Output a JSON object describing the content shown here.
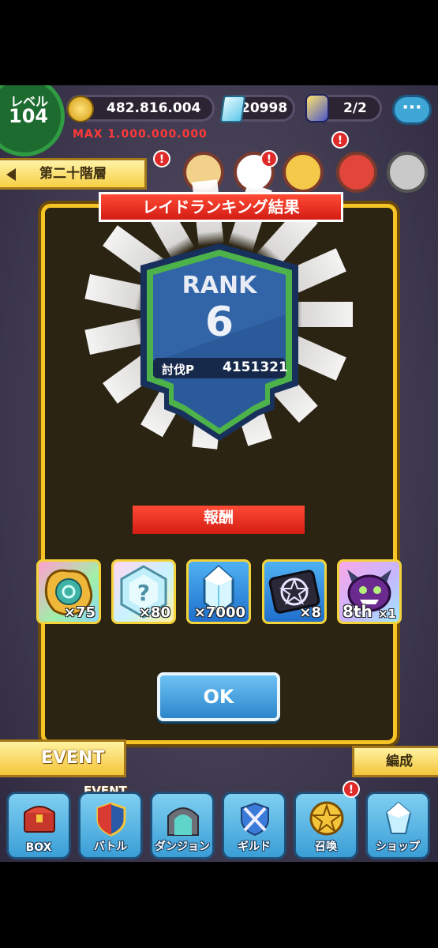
{
  "hud": {
    "level_label": "レベル",
    "level_value": "104",
    "gold": "482.816.004",
    "gold_max": "MAX 1.000.000.000",
    "gems": "20998",
    "stamina": "2/2",
    "chat_icon": "···",
    "floor": "第二十階層",
    "badges": [
      "!",
      "!",
      "!"
    ]
  },
  "dialog": {
    "title": "レイドランキング結果",
    "rank_label": "RANK",
    "rank_value": "6",
    "points_label": "討伐P",
    "points_value": "4151321",
    "reward_title": "報酬",
    "rewards": [
      {
        "icon": "gold-rune-icon",
        "qty": "×75"
      },
      {
        "icon": "mystery-crystal-icon",
        "qty": "×80"
      },
      {
        "icon": "blue-crystal-icon",
        "qty": "×7000"
      },
      {
        "icon": "summon-ticket-icon",
        "qty": "×8"
      },
      {
        "icon": "purple-monster-icon",
        "badge": "8th",
        "qty": "×1"
      }
    ],
    "ok_label": "OK"
  },
  "bottom": {
    "event_label": "EVENT",
    "edit_label": "編成",
    "nav_event_tag": "EVENT",
    "nav": [
      {
        "label": "BOX",
        "icon": "treasure-chest-icon"
      },
      {
        "label": "バトル",
        "icon": "shield-icon"
      },
      {
        "label": "ダンジョン",
        "icon": "dungeon-gate-icon"
      },
      {
        "label": "ギルド",
        "icon": "crossed-swords-icon"
      },
      {
        "label": "召喚",
        "icon": "pentagram-icon"
      },
      {
        "label": "ショップ",
        "icon": "crystal-icon"
      }
    ],
    "summon_badge": "!"
  },
  "colors": {
    "frame": "#f6c525",
    "ribbon": "#e8291b",
    "rank_shield": "#2a5a9a",
    "ok_button": "#3e98dc"
  }
}
